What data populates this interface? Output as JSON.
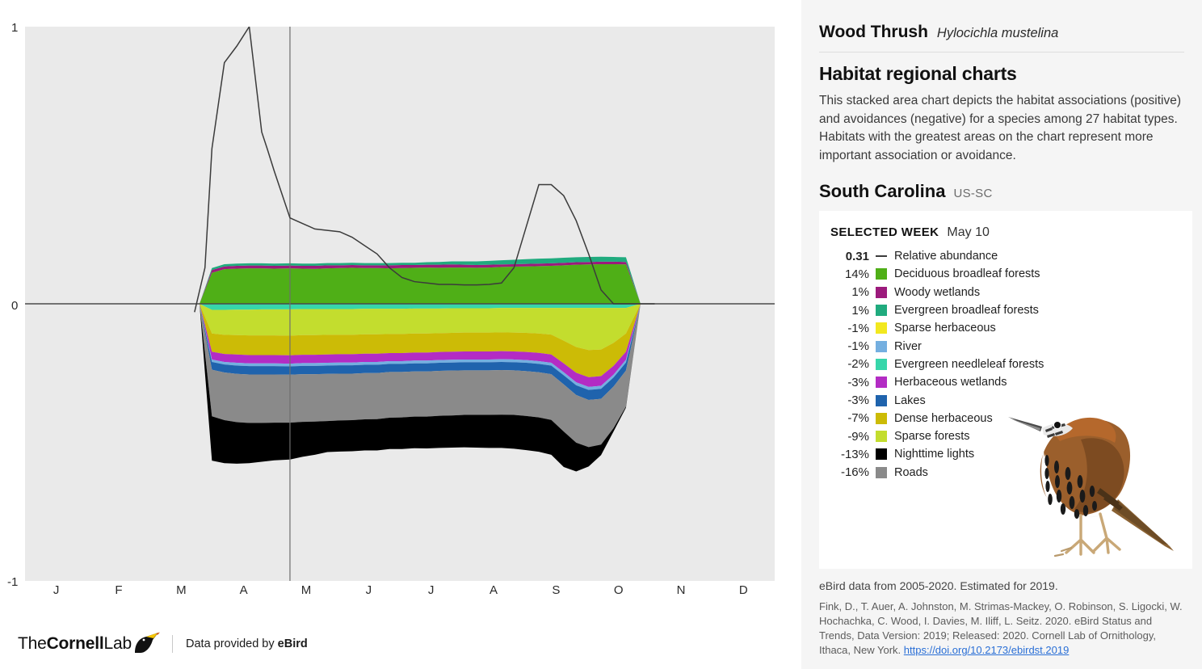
{
  "species": {
    "common_name": "Wood Thrush",
    "scientific_name": "Hylocichla mustelina"
  },
  "section": {
    "title": "Habitat regional charts",
    "description": "This stacked area chart depicts the habitat associations (positive) and avoidances (negative) for a species among 27 habitat types. Habitats with the greatest areas on the chart represent more important association or avoidance."
  },
  "region": {
    "name": "South Carolina",
    "code": "US-SC"
  },
  "legend": {
    "selected_week_label": "SELECTED WEEK",
    "selected_week_value": "May 10",
    "abundance": {
      "value": "0.31",
      "label": "Relative abundance",
      "color": "#3b3b3b"
    },
    "items": [
      {
        "value": "14%",
        "label": "Deciduous broadleaf forests",
        "color": "#4faf17"
      },
      {
        "value": "1%",
        "label": "Woody wetlands",
        "color": "#9c1a7c"
      },
      {
        "value": "1%",
        "label": "Evergreen broadleaf forests",
        "color": "#20ab7e"
      },
      {
        "value": "-1%",
        "label": "Sparse herbaceous",
        "color": "#f2e81f"
      },
      {
        "value": "-1%",
        "label": "River",
        "color": "#74afe0"
      },
      {
        "value": "-2%",
        "label": "Evergreen needleleaf forests",
        "color": "#37d6aa"
      },
      {
        "value": "-3%",
        "label": "Herbaceous wetlands",
        "color": "#b32cc4"
      },
      {
        "value": "-3%",
        "label": "Lakes",
        "color": "#1f63ad"
      },
      {
        "value": "-7%",
        "label": "Dense herbaceous",
        "color": "#ccbb06"
      },
      {
        "value": "-9%",
        "label": "Sparse forests",
        "color": "#c3dd2e"
      },
      {
        "value": "-13%",
        "label": "Nighttime lights",
        "color": "#000000"
      },
      {
        "value": "-16%",
        "label": "Roads",
        "color": "#8a8a8a"
      }
    ]
  },
  "attribution": {
    "data_years": "eBird data from 2005-2020. Estimated for 2019.",
    "citation": "Fink, D., T. Auer, A. Johnston, M. Strimas-Mackey, O. Robinson, S. Ligocki, W. Hochachka, C. Wood, I. Davies, M. Iliff, L. Seitz. 2020. eBird Status and Trends, Data Version: 2019; Released: 2020. Cornell Lab of Ornithology, Ithaca, New York. ",
    "doi": "https://doi.org/10.2173/ebirdst.2019"
  },
  "brand": {
    "wordmark_the": "The",
    "wordmark_cornell": "Cornell",
    "wordmark_lab": "Lab",
    "credit_prefix": "Data provided by ",
    "credit_brand": "eBird"
  },
  "chart_data": {
    "type": "area",
    "title": "Habitat regional charts",
    "xlabel": "",
    "ylabel": "",
    "ylim": [
      -1,
      1
    ],
    "ytick_labels": [
      "1",
      "0",
      "-1"
    ],
    "ytick_values": [
      1,
      0,
      -1
    ],
    "grid": false,
    "legend_position": "right-panel",
    "x_tick_labels": [
      "J",
      "F",
      "M",
      "A",
      "M",
      "J",
      "J",
      "A",
      "S",
      "O",
      "N",
      "D"
    ],
    "selected_week_marker": {
      "label": "May 10",
      "x_fraction": 0.3534,
      "abundance": 0.31
    },
    "x_domain_fraction": {
      "start": 0.2327,
      "end": 0.8211
    },
    "x_fractions": [
      0.2327,
      0.2493,
      0.2659,
      0.2825,
      0.2991,
      0.3157,
      0.3323,
      0.3534,
      0.37,
      0.3866,
      0.4032,
      0.4198,
      0.4364,
      0.453,
      0.4696,
      0.4862,
      0.5028,
      0.5194,
      0.536,
      0.5526,
      0.5692,
      0.5858,
      0.6024,
      0.619,
      0.6356,
      0.6522,
      0.6688,
      0.6854,
      0.702,
      0.7186,
      0.7352,
      0.7518,
      0.7684,
      0.785,
      0.8016,
      0.8211
    ],
    "series_positive": [
      {
        "name": "Deciduous broadleaf forests",
        "color": "#4faf17",
        "values": [
          0.0,
          0.112,
          0.125,
          0.127,
          0.128,
          0.128,
          0.127,
          0.128,
          0.127,
          0.126,
          0.128,
          0.129,
          0.13,
          0.129,
          0.129,
          0.128,
          0.129,
          0.13,
          0.131,
          0.13,
          0.131,
          0.131,
          0.13,
          0.131,
          0.133,
          0.134,
          0.135,
          0.136,
          0.137,
          0.139,
          0.141,
          0.142,
          0.143,
          0.143,
          0.142,
          0.0
        ]
      },
      {
        "name": "Woody wetlands",
        "color": "#9c1a7c",
        "values": [
          0.0,
          0.01,
          0.01,
          0.01,
          0.01,
          0.01,
          0.01,
          0.01,
          0.01,
          0.011,
          0.011,
          0.01,
          0.01,
          0.01,
          0.01,
          0.011,
          0.011,
          0.01,
          0.01,
          0.011,
          0.011,
          0.01,
          0.01,
          0.01,
          0.009,
          0.009,
          0.009,
          0.009,
          0.009,
          0.009,
          0.009,
          0.009,
          0.009,
          0.009,
          0.009,
          0.0
        ]
      },
      {
        "name": "Evergreen broadleaf forests",
        "color": "#20ab7e",
        "values": [
          0.0,
          0.007,
          0.008,
          0.008,
          0.008,
          0.008,
          0.008,
          0.008,
          0.008,
          0.008,
          0.008,
          0.008,
          0.008,
          0.008,
          0.008,
          0.008,
          0.008,
          0.008,
          0.009,
          0.01,
          0.011,
          0.012,
          0.013,
          0.014,
          0.015,
          0.016,
          0.017,
          0.018,
          0.018,
          0.018,
          0.018,
          0.018,
          0.018,
          0.017,
          0.017,
          0.0
        ]
      }
    ],
    "series_negative": [
      {
        "name": "Evergreen needleleaf forests",
        "color": "#37d6aa",
        "values": [
          0.0,
          -0.022,
          -0.022,
          -0.021,
          -0.021,
          -0.02,
          -0.02,
          -0.02,
          -0.019,
          -0.019,
          -0.019,
          -0.019,
          -0.019,
          -0.018,
          -0.018,
          -0.018,
          -0.018,
          -0.017,
          -0.017,
          -0.017,
          -0.016,
          -0.016,
          -0.016,
          -0.016,
          -0.015,
          -0.015,
          -0.015,
          -0.015,
          -0.015,
          -0.015,
          -0.015,
          -0.015,
          -0.015,
          -0.015,
          -0.015,
          0.0
        ]
      },
      {
        "name": "Sparse forests",
        "color": "#c3dd2e",
        "values": [
          0.0,
          -0.085,
          -0.09,
          -0.092,
          -0.093,
          -0.094,
          -0.094,
          -0.095,
          -0.094,
          -0.094,
          -0.093,
          -0.093,
          -0.093,
          -0.092,
          -0.092,
          -0.091,
          -0.091,
          -0.09,
          -0.09,
          -0.089,
          -0.089,
          -0.088,
          -0.088,
          -0.088,
          -0.088,
          -0.089,
          -0.09,
          -0.092,
          -0.096,
          -0.118,
          -0.141,
          -0.152,
          -0.15,
          -0.126,
          -0.092,
          0.0
        ]
      },
      {
        "name": "Dense herbaceous",
        "color": "#ccbb06",
        "values": [
          0.0,
          -0.066,
          -0.069,
          -0.07,
          -0.071,
          -0.071,
          -0.071,
          -0.071,
          -0.071,
          -0.071,
          -0.071,
          -0.07,
          -0.07,
          -0.07,
          -0.07,
          -0.069,
          -0.069,
          -0.069,
          -0.069,
          -0.068,
          -0.068,
          -0.068,
          -0.068,
          -0.068,
          -0.068,
          -0.068,
          -0.069,
          -0.07,
          -0.072,
          -0.082,
          -0.093,
          -0.098,
          -0.096,
          -0.083,
          -0.066,
          0.0
        ]
      },
      {
        "name": "Herbaceous wetlands",
        "color": "#b32cc4",
        "values": [
          0.0,
          -0.028,
          -0.029,
          -0.03,
          -0.03,
          -0.03,
          -0.03,
          -0.03,
          -0.03,
          -0.03,
          -0.03,
          -0.03,
          -0.03,
          -0.03,
          -0.03,
          -0.029,
          -0.029,
          -0.029,
          -0.029,
          -0.029,
          -0.029,
          -0.029,
          -0.029,
          -0.029,
          -0.029,
          -0.029,
          -0.029,
          -0.03,
          -0.03,
          -0.032,
          -0.034,
          -0.035,
          -0.035,
          -0.032,
          -0.029,
          0.0
        ]
      },
      {
        "name": "River",
        "color": "#74afe0",
        "values": [
          0.0,
          -0.009,
          -0.009,
          -0.01,
          -0.01,
          -0.01,
          -0.01,
          -0.01,
          -0.01,
          -0.01,
          -0.01,
          -0.01,
          -0.01,
          -0.01,
          -0.01,
          -0.01,
          -0.01,
          -0.01,
          -0.01,
          -0.01,
          -0.01,
          -0.01,
          -0.01,
          -0.01,
          -0.01,
          -0.01,
          -0.01,
          -0.01,
          -0.01,
          -0.011,
          -0.011,
          -0.011,
          -0.011,
          -0.01,
          -0.01,
          0.0
        ]
      },
      {
        "name": "Lakes",
        "color": "#1f63ad",
        "values": [
          0.0,
          -0.028,
          -0.029,
          -0.03,
          -0.03,
          -0.03,
          -0.03,
          -0.03,
          -0.03,
          -0.03,
          -0.03,
          -0.03,
          -0.03,
          -0.03,
          -0.03,
          -0.029,
          -0.029,
          -0.029,
          -0.029,
          -0.029,
          -0.029,
          -0.029,
          -0.029,
          -0.029,
          -0.029,
          -0.029,
          -0.03,
          -0.03,
          -0.031,
          -0.033,
          -0.035,
          -0.036,
          -0.036,
          -0.033,
          -0.029,
          0.0
        ]
      },
      {
        "name": "Roads",
        "color": "#8a8a8a",
        "values": [
          0.0,
          -0.168,
          -0.172,
          -0.174,
          -0.175,
          -0.175,
          -0.174,
          -0.173,
          -0.172,
          -0.171,
          -0.17,
          -0.169,
          -0.168,
          -0.167,
          -0.166,
          -0.165,
          -0.164,
          -0.163,
          -0.163,
          -0.162,
          -0.162,
          -0.161,
          -0.161,
          -0.161,
          -0.161,
          -0.161,
          -0.162,
          -0.163,
          -0.165,
          -0.17,
          -0.172,
          -0.17,
          -0.165,
          -0.15,
          -0.13,
          0.0
        ]
      },
      {
        "name": "Nighttime lights",
        "color": "#000000",
        "values": [
          0.0,
          -0.16,
          -0.155,
          -0.15,
          -0.145,
          -0.14,
          -0.136,
          -0.133,
          -0.126,
          -0.12,
          -0.112,
          -0.112,
          -0.112,
          -0.112,
          -0.113,
          -0.113,
          -0.114,
          -0.114,
          -0.115,
          -0.116,
          -0.116,
          -0.117,
          -0.118,
          -0.119,
          -0.12,
          -0.122,
          -0.123,
          -0.124,
          -0.126,
          -0.128,
          -0.104,
          -0.07,
          -0.038,
          -0.012,
          -0.004,
          0.0
        ]
      }
    ],
    "abundance_line": {
      "name": "Relative abundance",
      "color": "#3b3b3b",
      "x_fractions": [
        0.2261,
        0.24,
        0.2493,
        0.2659,
        0.2825,
        0.2991,
        0.3157,
        0.323,
        0.3323,
        0.3534,
        0.37,
        0.3866,
        0.4032,
        0.4198,
        0.4364,
        0.453,
        0.4696,
        0.4862,
        0.5028,
        0.5194,
        0.536,
        0.5526,
        0.5692,
        0.5858,
        0.6024,
        0.619,
        0.6356,
        0.6522,
        0.6688,
        0.6854,
        0.702,
        0.7186,
        0.7352,
        0.7518,
        0.7684,
        0.785,
        0.8016,
        0.8211,
        0.84
      ],
      "values": [
        -0.03,
        0.13,
        0.56,
        0.87,
        0.93,
        1.0,
        0.62,
        0.56,
        0.48,
        0.31,
        0.29,
        0.27,
        0.265,
        0.26,
        0.24,
        0.21,
        0.18,
        0.13,
        0.095,
        0.08,
        0.075,
        0.07,
        0.07,
        0.068,
        0.068,
        0.07,
        0.075,
        0.13,
        0.28,
        0.43,
        0.43,
        0.39,
        0.3,
        0.18,
        0.05,
        0.0,
        0.0,
        0.0,
        0.0
      ]
    }
  }
}
